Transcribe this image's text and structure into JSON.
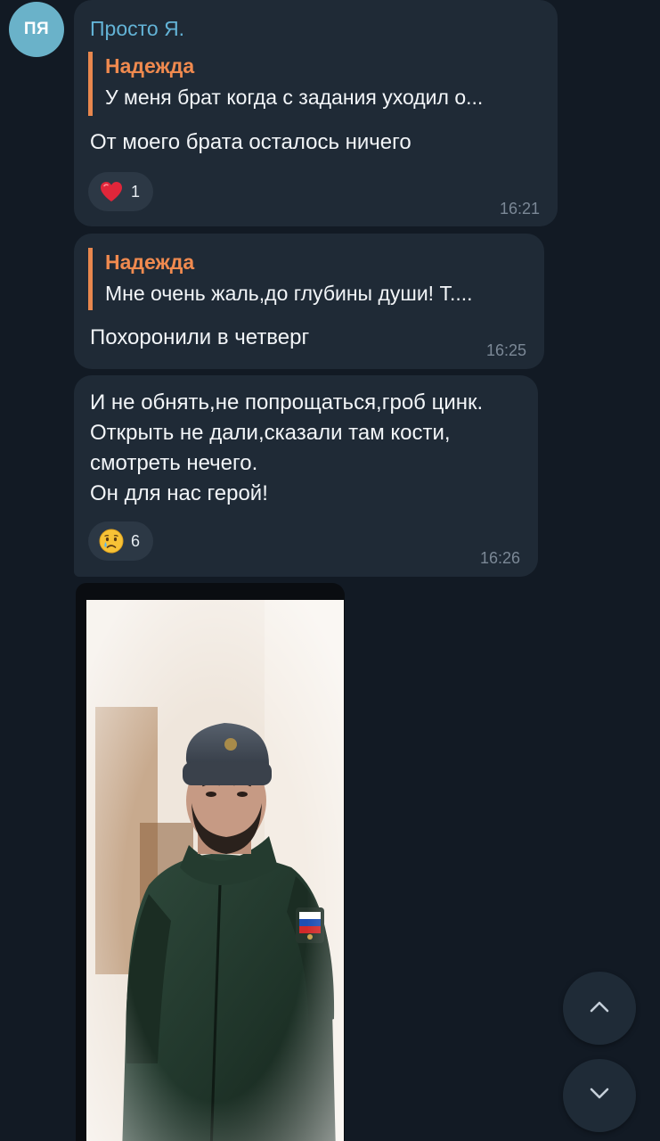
{
  "sender": {
    "avatar_initials": "ПЯ",
    "name": "Просто Я.",
    "avatar_color": "#6ab2c9"
  },
  "messages": [
    {
      "reply_author": "Надежда",
      "reply_text": "У меня брат когда с задания уходил о...",
      "text": "От моего брата осталось ничего",
      "reaction": {
        "emoji": "❤️",
        "icon": "heart-icon",
        "count": "1"
      },
      "time": "16:21"
    },
    {
      "reply_author": "Надежда",
      "reply_text": "Мне очень жаль,до глубины души! Т....",
      "text": "Похоронили в четверг",
      "time": "16:25"
    },
    {
      "text": "И не обнять,не попрощаться,гроб цинк.\nОткрыть не дали,сказали там кости,\nсмотреть нечего.\nОн для нас герой!",
      "reaction": {
        "emoji": "😢",
        "icon": "crying-face-icon",
        "count": "6"
      },
      "time": "16:26"
    }
  ],
  "photo": {
    "description_icon": "soldier-photo"
  },
  "colors": {
    "background": "#121a24",
    "bubble": "#1f2a36",
    "reply_accent": "#e8874e",
    "sender_name": "#63b3d6"
  },
  "controls": {
    "scroll_up_icon": "chevron-up-icon",
    "scroll_down_icon": "chevron-down-icon"
  }
}
